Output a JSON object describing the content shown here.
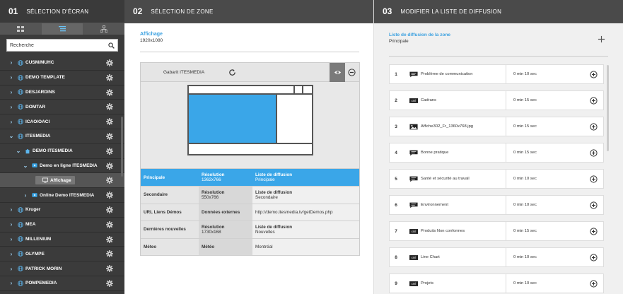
{
  "col1": {
    "num": "01",
    "title": "SÉLECTION D'ÉCRAN",
    "search": {
      "value": "Recherche",
      "placeholder": "Recherche"
    },
    "items": [
      {
        "label": "CUSM/MUHC",
        "chevron": ">",
        "icon": "globe-icon"
      },
      {
        "label": "DEMO TEMPLATE",
        "chevron": ">",
        "icon": "globe-icon"
      },
      {
        "label": "DESJARDINS",
        "chevron": ">",
        "icon": "globe-icon"
      },
      {
        "label": "DOMTAR",
        "chevron": ">",
        "icon": "globe-icon"
      },
      {
        "label": "ICAO/OACI",
        "chevron": ">",
        "icon": "globe-icon"
      },
      {
        "label": "ITESMEDIA",
        "chevron": "v",
        "icon": "globe-icon"
      },
      {
        "label": "DEMO ITESMEDIA",
        "chevron": "v",
        "icon": "home-icon"
      },
      {
        "label": "Demo en ligne ITESMEDIA",
        "chevron": "v",
        "icon": "screen-icon"
      },
      {
        "label": "Affichage",
        "chevron": "",
        "icon": "monitor-icon"
      },
      {
        "label": "Online Demo ITESMEDIA",
        "chevron": ">",
        "icon": "screen-icon"
      },
      {
        "label": "Kruger",
        "chevron": ">",
        "icon": "globe-icon"
      },
      {
        "label": "MEA",
        "chevron": ">",
        "icon": "globe-icon"
      },
      {
        "label": "MILLENIUM",
        "chevron": ">",
        "icon": "globe-icon"
      },
      {
        "label": "OLYMPE",
        "chevron": ">",
        "icon": "globe-icon"
      },
      {
        "label": "PATRICK MORIN",
        "chevron": ">",
        "icon": "globe-icon"
      },
      {
        "label": "POMPEMEDIA",
        "chevron": ">",
        "icon": "globe-icon"
      }
    ]
  },
  "col2": {
    "num": "02",
    "title": "SÉLECTION DE ZONE",
    "display_name": "Affichage",
    "display_res": "1920x1080",
    "template_name": "Gabarit ITESMEDIA",
    "zones": [
      {
        "name": "Principale",
        "l2": "Résolution",
        "v2": "1362x766",
        "l3": "Liste de diffusion",
        "v3": "Principale",
        "active": true
      },
      {
        "name": "Secondaire",
        "l2": "Résolution",
        "v2": "550x766",
        "l3": "Liste de diffusion",
        "v3": "Secondaire",
        "active": false
      },
      {
        "name": "URL Liens Démos",
        "l2": "Données externes",
        "v2": "",
        "l3": "",
        "v3": "http://demo.itesmedia.tv/getDemos.php",
        "active": false
      },
      {
        "name": "Dernières nouvelles",
        "l2": "Résolution",
        "v2": "1730x168",
        "l3": "Liste de diffusion",
        "v3": "Nouvelles",
        "active": false
      },
      {
        "name": "Méteo",
        "l2": "Météo",
        "v2": "",
        "l3": "",
        "v3": "Montréal",
        "active": false
      }
    ]
  },
  "col3": {
    "num": "03",
    "title": "MODIFIER LA LISTE DE DIFFUSION",
    "list_title": "Liste de diffusion de la zone",
    "list_sub": "Principale",
    "items": [
      {
        "idx": "1",
        "type": "message-icon",
        "name": "Problème de communication",
        "dur": "0 min 10 sec"
      },
      {
        "idx": "2",
        "type": "xml-icon",
        "name": "Cadrans",
        "dur": "0 min 15 sec"
      },
      {
        "idx": "3",
        "type": "image-icon",
        "name": "Affiche302_Fr_1360x768.jpg",
        "dur": "0 min 15 sec"
      },
      {
        "idx": "4",
        "type": "message-icon",
        "name": "Bonne pratique",
        "dur": "0 min 15 sec"
      },
      {
        "idx": "5",
        "type": "message-icon",
        "name": "Santé et sécurité au travail",
        "dur": "0 min 10 sec"
      },
      {
        "idx": "6",
        "type": "message-icon",
        "name": "Environnement",
        "dur": "0 min 10 sec"
      },
      {
        "idx": "7",
        "type": "xml-icon",
        "name": "Produits Non conformes",
        "dur": "0 min 15 sec"
      },
      {
        "idx": "8",
        "type": "xml-icon",
        "name": "Line Chart",
        "dur": "0 min 10 sec"
      },
      {
        "idx": "9",
        "type": "xml-icon",
        "name": "Projets",
        "dur": "0 min 10 sec"
      }
    ]
  },
  "colors": {
    "accent": "#3aa6e8",
    "dark": "#3b3b3b",
    "header": "#4a4a4a"
  }
}
